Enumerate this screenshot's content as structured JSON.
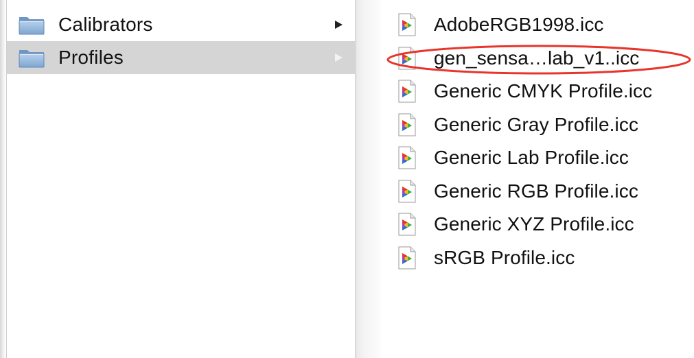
{
  "folders": [
    {
      "label": "Calibrators",
      "selected": false,
      "icon": "folder-icon"
    },
    {
      "label": "Profiles",
      "selected": true,
      "icon": "folder-icon"
    }
  ],
  "files": [
    {
      "label": "AdobeRGB1998.icc",
      "icon": "icc-profile-icon"
    },
    {
      "label": "gen_sensa…lab_v1..icc",
      "icon": "icc-profile-icon",
      "highlighted": true
    },
    {
      "label": "Generic CMYK Profile.icc",
      "icon": "icc-profile-icon"
    },
    {
      "label": "Generic Gray Profile.icc",
      "icon": "icc-profile-icon"
    },
    {
      "label": "Generic Lab Profile.icc",
      "icon": "icc-profile-icon"
    },
    {
      "label": "Generic RGB Profile.icc",
      "icon": "icc-profile-icon"
    },
    {
      "label": "Generic XYZ Profile.icc",
      "icon": "icc-profile-icon"
    },
    {
      "label": "sRGB Profile.icc",
      "icon": "icc-profile-icon"
    }
  ],
  "colors": {
    "selection": "#d5d5d5",
    "annotation": "#e8352b",
    "folder": "#8fb3d9"
  }
}
